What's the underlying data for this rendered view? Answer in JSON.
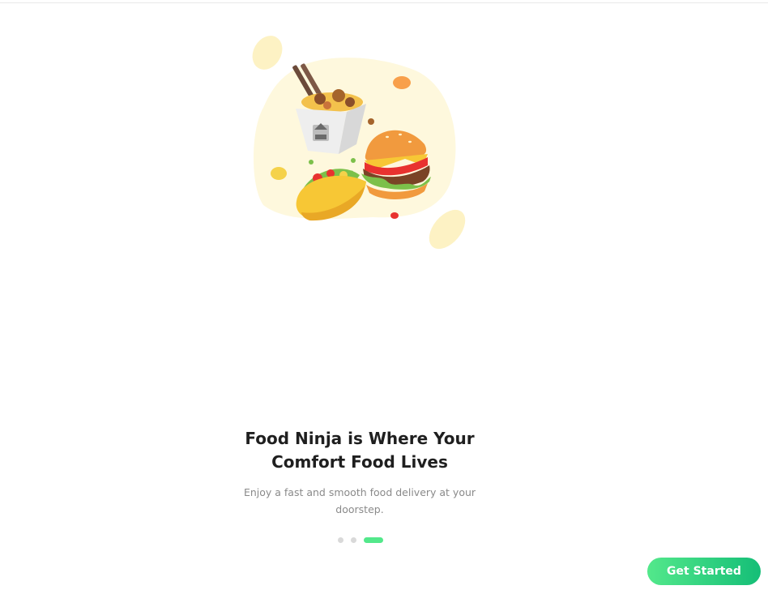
{
  "colors": {
    "accent": "#53e88b",
    "accent_gradient_start": "#53e88b",
    "accent_gradient_end": "#15be77",
    "blob": "#fef8dd",
    "headline": "#1f1f1f",
    "subtext": "#8a8a8a",
    "dot_inactive": "#d9d9d9"
  },
  "onboarding": {
    "title": "Food Ninja is Where Your Comfort Food Lives",
    "description": "Enjoy a fast and smooth food delivery at your doorstep.",
    "illustration_icons": [
      "noodle-box-icon",
      "burger-icon",
      "taco-icon"
    ],
    "pagination": {
      "total": 3,
      "current": 3
    },
    "cta_label": "Get Started"
  }
}
